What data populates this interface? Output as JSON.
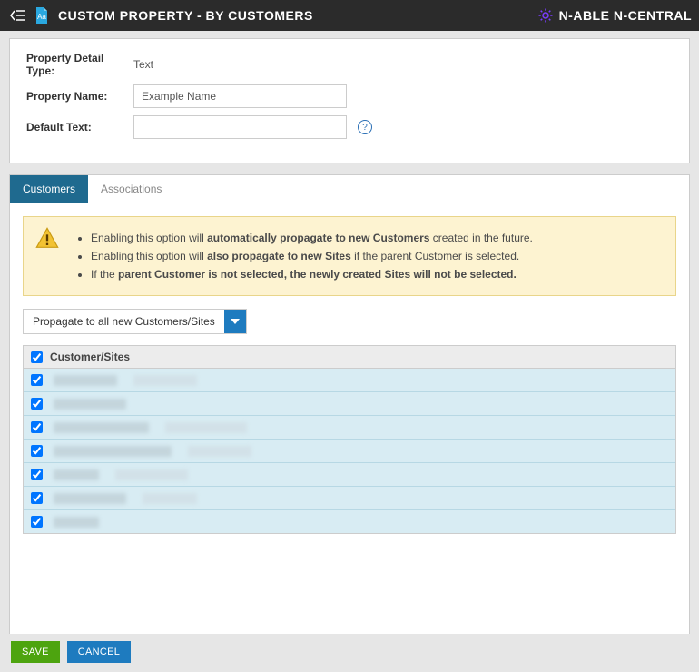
{
  "header": {
    "title": "CUSTOM PROPERTY - BY CUSTOMERS",
    "brand": "N-ABLE N-CENTRAL"
  },
  "detail": {
    "type_label": "Property Detail Type:",
    "type_value": "Text",
    "name_label": "Property Name:",
    "name_value": "Example Name",
    "default_label": "Default Text:",
    "default_value": ""
  },
  "tabs": {
    "customers": "Customers",
    "associations": "Associations"
  },
  "alert": {
    "line1_pre": "Enabling this option will ",
    "line1_bold": "automatically propagate to new Customers",
    "line1_post": " created in the future.",
    "line2_pre": "Enabling this option will ",
    "line2_bold": "also propagate to new Sites",
    "line2_post": " if the parent Customer is selected.",
    "line3_pre": "If the ",
    "line3_bold": "parent Customer is not selected, the newly created Sites will not be selected.",
    "line3_post": ""
  },
  "propagate": {
    "label": "Propagate to all new Customers/Sites"
  },
  "grid": {
    "header_label": "Customer/Sites",
    "rows": [
      {
        "checked": true,
        "a_w": 70,
        "b_w": 70
      },
      {
        "checked": true,
        "a_w": 80,
        "b_w": 0
      },
      {
        "checked": true,
        "a_w": 105,
        "b_w": 90
      },
      {
        "checked": true,
        "a_w": 130,
        "b_w": 70
      },
      {
        "checked": true,
        "a_w": 50,
        "b_w": 80
      },
      {
        "checked": true,
        "a_w": 80,
        "b_w": 60
      },
      {
        "checked": true,
        "a_w": 50,
        "b_w": 0
      }
    ]
  },
  "footer": {
    "save": "SAVE",
    "cancel": "CANCEL"
  }
}
